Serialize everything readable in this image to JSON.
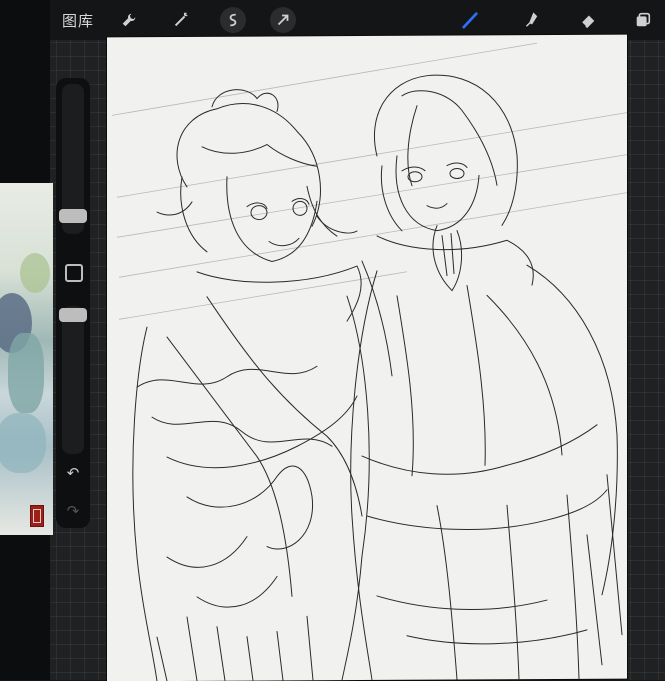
{
  "toolbar": {
    "gallery_label": "图库",
    "tools": [
      {
        "name": "wrench-icon"
      },
      {
        "name": "magic-wand-icon"
      },
      {
        "name": "selection-icon"
      },
      {
        "name": "transform-arrow-icon"
      },
      {
        "name": "brush-icon"
      },
      {
        "name": "smudge-icon"
      },
      {
        "name": "eraser-icon"
      },
      {
        "name": "layers-icon"
      }
    ],
    "active_tool": "brush-icon",
    "accent_color": "#2f6df6"
  },
  "sidebar": {
    "brush_size_level": 0.75,
    "opacity_level": 0.15,
    "modify_button": "square-icon",
    "undo_icon": "undo-icon",
    "redo_icon": "redo-icon"
  }
}
